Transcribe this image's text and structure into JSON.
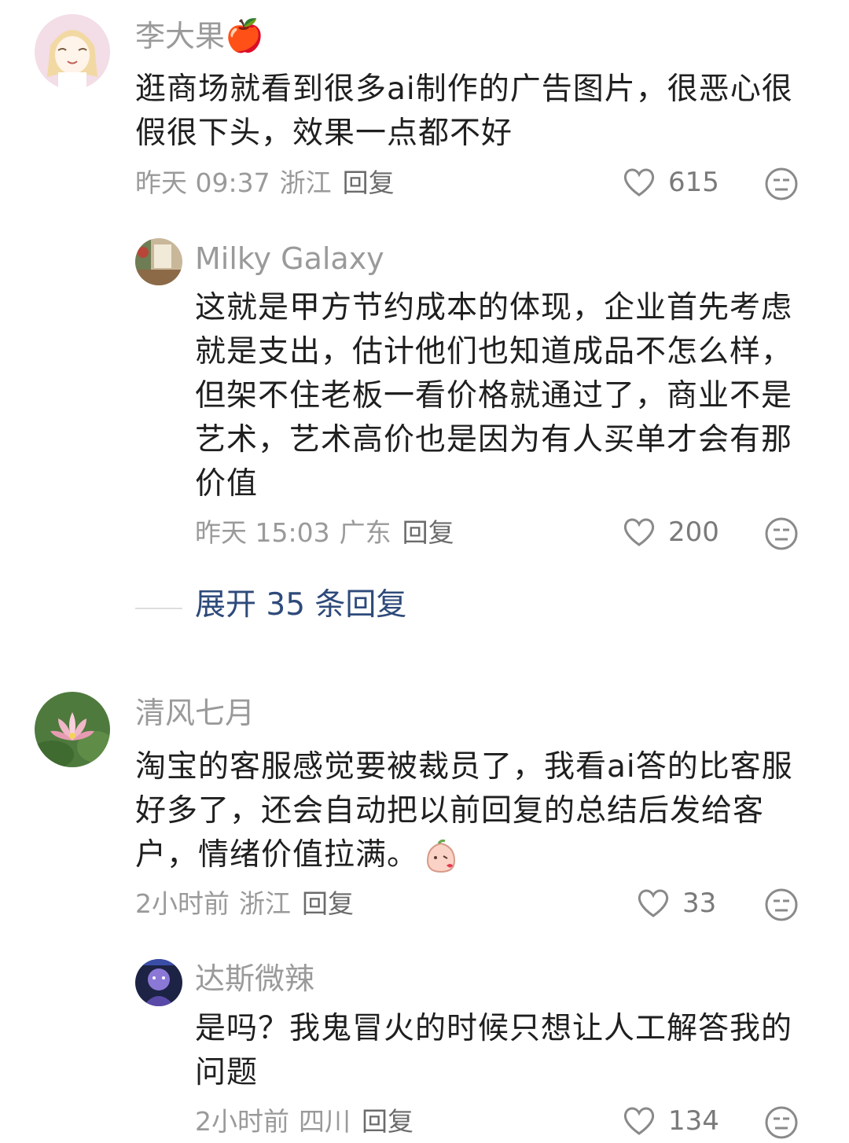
{
  "comments": [
    {
      "username": "李大果",
      "username_emoji": "🍎",
      "text": "逛商场就看到很多ai制作的广告图片，很恶心很假很下头，效果一点都不好",
      "time": "昨天 09:37",
      "location": "浙江",
      "reply_label": "回复",
      "likes": "615",
      "avatar_icon": "anime-girl-avatar"
    },
    {
      "username": "Milky Galaxy",
      "text": "这就是甲方节约成本的体现，企业首先考虑就是支出，估计他们也知道成品不怎么样，但架不住老板一看价格就通过了，商业不是艺术，艺术高价也是因为有人买单才会有那价值",
      "time": "昨天 15:03",
      "location": "广东",
      "reply_label": "回复",
      "likes": "200",
      "avatar_icon": "room-photo-avatar"
    },
    {
      "username": "清风七月",
      "text": "淘宝的客服感觉要被裁员了，我看ai答的比客服好多了，还会自动把以前回复的总结后发给客户，情绪价值拉满。",
      "time": "2小时前",
      "location": "浙江",
      "reply_label": "回复",
      "likes": "33",
      "avatar_icon": "lotus-avatar",
      "inline_emoji": "peach-kiss-emoji"
    },
    {
      "username": "达斯微辣",
      "text": "是吗？我鬼冒火的时候只想让人工解答我的问题",
      "time": "2小时前",
      "location": "四川",
      "reply_label": "回复",
      "likes": "134",
      "avatar_icon": "purple-character-avatar"
    }
  ],
  "expand_replies": "展开 35 条回复",
  "colors": {
    "secondary_text": "#9a9a9a",
    "body_text": "#1f1f1f",
    "link": "#2e4a7a"
  }
}
